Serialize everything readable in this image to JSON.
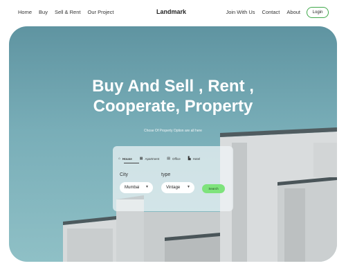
{
  "nav": {
    "left_links": [
      "Home",
      "Buy",
      "Sell & Rent",
      "Our Project"
    ],
    "brand": "Landmark",
    "right_links": [
      "Join With Us",
      "Contact",
      "About"
    ],
    "login_label": "Login"
  },
  "hero": {
    "headline_line1": "Buy And Sell , Rent ,",
    "headline_line2": "Cooperate, Property",
    "subtitle": "Chose Of Property Option are all here"
  },
  "search": {
    "tabs": [
      {
        "label": "House",
        "icon": "house-icon",
        "active": true
      },
      {
        "label": "Apartment",
        "icon": "apartment-icon",
        "active": false
      },
      {
        "label": "Office",
        "icon": "office-icon",
        "active": false
      },
      {
        "label": "Hotel",
        "icon": "hotel-icon",
        "active": false
      }
    ],
    "city_label": "City",
    "city_value": "Mumbai",
    "type_label": "type",
    "type_value": "Vintage",
    "button_label": "Search"
  },
  "colors": {
    "accent_green": "#7ee37c",
    "login_border": "#3fa84a",
    "sky": "#79aeb8"
  }
}
